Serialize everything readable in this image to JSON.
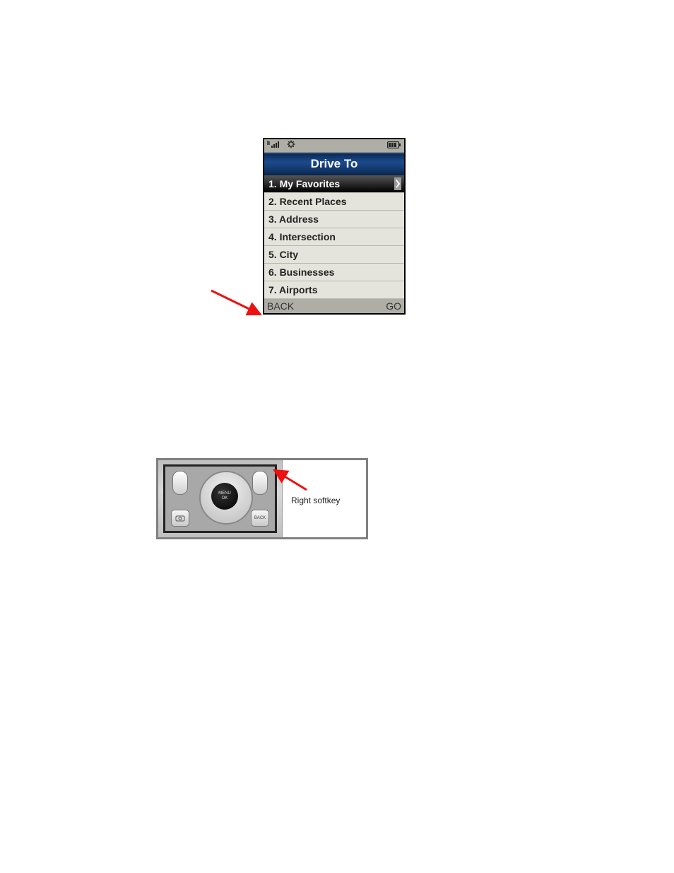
{
  "phone": {
    "title": "Drive To",
    "menu_items": [
      "1. My Favorites",
      "2. Recent Places",
      "3. Address",
      "4. Intersection",
      "5. City",
      "6. Businesses",
      "7. Airports"
    ],
    "selected_index": 0,
    "softkeys": {
      "left": "BACK",
      "right": "GO"
    }
  },
  "keypad": {
    "center_label": "MENU\nOK",
    "back_key_label": "BACK",
    "caption": "Right softkey"
  }
}
